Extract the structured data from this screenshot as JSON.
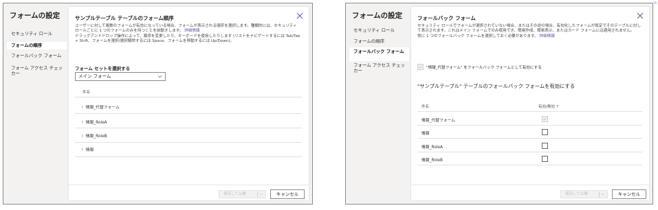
{
  "left": {
    "nav": {
      "title": "フォームの設定",
      "items": [
        {
          "label": "セキュリティ ロール"
        },
        {
          "label": "フォームの順序"
        },
        {
          "label": "フォールバック フォーム"
        },
        {
          "label": "フォーム アクセス チェッカー"
        }
      ]
    },
    "dialog": {
      "title": "サンプルテーブル テーブルのフォーム順序",
      "desc1": "ユーザーに対して複数のフォームが有効になっている場合、フォームが表示される順序を選択します。種類的には、セキュリティ ロールごとに 1 つのフォームのみを持つことを前動きします。",
      "desc1_link": "詳細情報",
      "desc2": "ドラッグアンドドロップ操作によって、順序を変更したり、キーボードを使用したりします (リストをナビゲートするには Tab/Tab + Shift、フォームを選択/選択解除するには Space、フォームを移動するには Up/Down)。",
      "formset_label": "フォーム セットを選択する",
      "formset_value": "メイン フォーム",
      "col_name": "件名",
      "rows": [
        "情報_代替フォーム",
        "情報_RoleA",
        "情報_RoleB",
        "情報"
      ],
      "save_label": "保存して公開",
      "cancel_label": "キャンセル"
    }
  },
  "right": {
    "nav": {
      "title": "フォームの設定",
      "items": [
        {
          "label": "セキュリティ ロール"
        },
        {
          "label": "フォームの順序"
        },
        {
          "label": "フォールバック フォーム"
        },
        {
          "label": "フォーム アクセス チェッカー"
        }
      ]
    },
    "dialog": {
      "title": "フォールバック フォーム",
      "desc1": "セキュリティ ロールでフォームが選択されていない場合、またはその逆の場合、有効化したフォームが既定でそのテーブルに対して表示されます。これはメイン フォームでのみ使用でき、簡易作成、簡易表示、またはカード フォームには適用されません。",
      "desc2": "常に 1 つのフォールバック フォームを選択しておく必要があります。",
      "desc2_link": "詳細情報",
      "enable_label": "\"情報_代替フォーム\" をフォールバック フォームとして有効にする",
      "section_title": "\"サンプルテーブル\" テーブルのフォールバック フォームを有効にする",
      "col_name": "件名",
      "col_enabled": "有効/無効 ↑",
      "rows": [
        {
          "name": "情報_代替フォーム",
          "checked": true,
          "disabled": true
        },
        {
          "name": "情報",
          "checked": false,
          "disabled": false
        },
        {
          "name": "情報_RoleA",
          "checked": false,
          "disabled": false
        },
        {
          "name": "情報_RoleB",
          "checked": false,
          "disabled": false
        }
      ],
      "save_label": "保存して公開",
      "cancel_label": "キャンセル"
    }
  }
}
